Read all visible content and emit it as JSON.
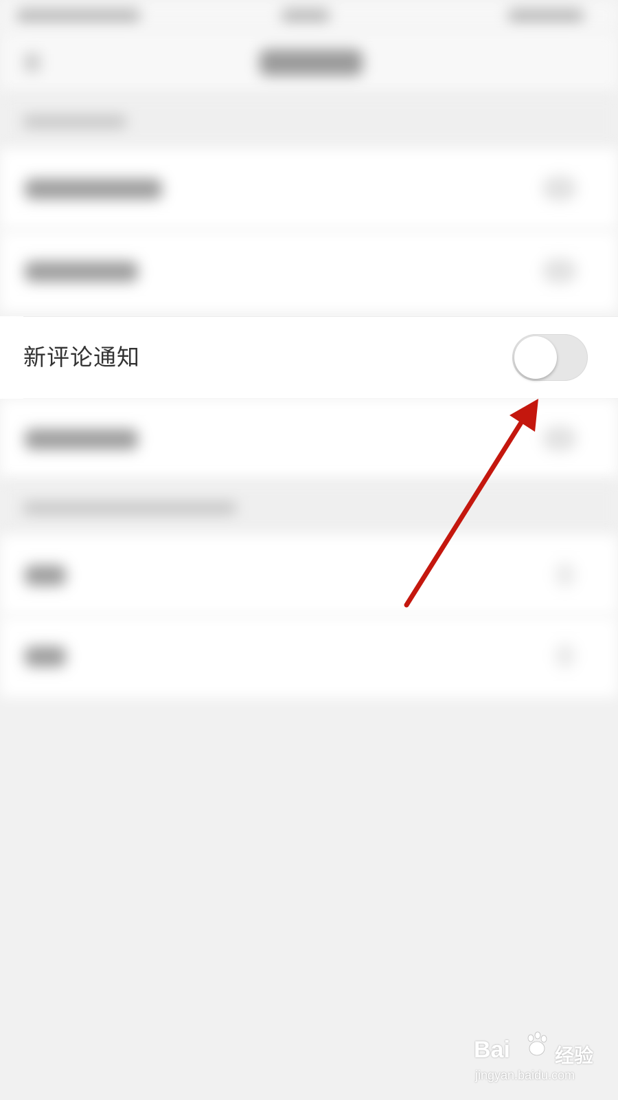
{
  "settings": {
    "new_comment_notification": {
      "label": "新评论通知",
      "toggle_on": false
    }
  },
  "colors": {
    "annotation_arrow": "#c4170e",
    "toggle_off_track": "#e6e6e6",
    "page_background": "#f1f1f1"
  },
  "watermark": {
    "brand": "Bai",
    "paw_icon": "baidu-paw-icon",
    "brand_suffix": "经验",
    "url": "jingyan.baidu.com"
  }
}
